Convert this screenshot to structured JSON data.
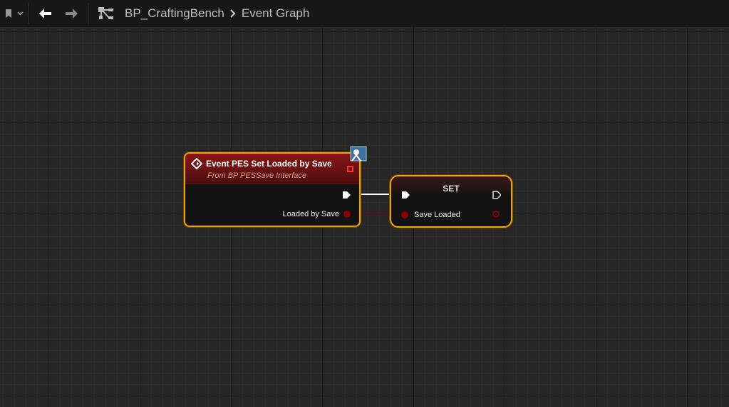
{
  "toolbar": {
    "bookmark_icon": "bookmark-icon",
    "back_icon": "arrow-left-icon",
    "forward_icon": "arrow-right-icon",
    "blueprint_name": "BP_CraftingBench",
    "graph_name": "Event Graph"
  },
  "nodes": {
    "event": {
      "title": "Event PES Set Loaded by Save",
      "subtitle": "From BP PESSave Interface",
      "output_pin": "Loaded by Save"
    },
    "set": {
      "title": "SET",
      "input_pin": "Save Loaded"
    }
  },
  "colors": {
    "selection": "#f0a000",
    "event_header": "#8a1414",
    "bool_pin": "#8b0000"
  }
}
